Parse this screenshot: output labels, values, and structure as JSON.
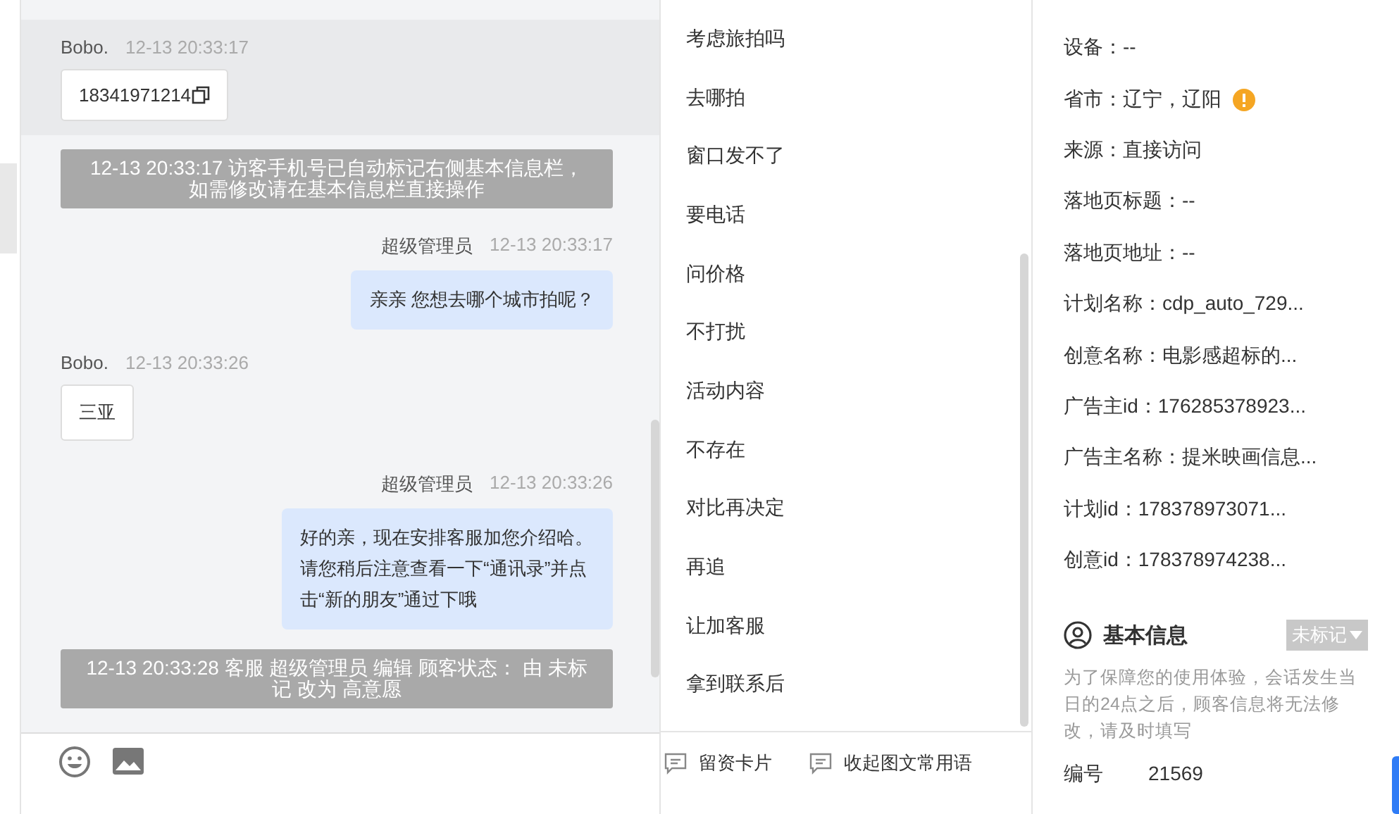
{
  "chat": {
    "messages": [
      {
        "kind": "incoming",
        "sender": "Bobo.",
        "time": "12-13 20:33:17",
        "text": "18341971214",
        "copyable": true,
        "highlighted": true
      },
      {
        "kind": "system",
        "text": "12-13 20:33:17 访客手机号已自动标记右侧基本信息栏，如需修改请在基本信息栏直接操作"
      },
      {
        "kind": "outgoing",
        "sender": "超级管理员",
        "time": "12-13 20:33:17",
        "text": "亲亲 您想去哪个城市拍呢？"
      },
      {
        "kind": "incoming",
        "sender": "Bobo.",
        "time": "12-13 20:33:26",
        "text": "三亚",
        "copyable": false,
        "highlighted": false
      },
      {
        "kind": "outgoing",
        "sender": "超级管理员",
        "time": "12-13 20:33:26",
        "text": "好的亲，现在安排客服加您介绍哈。请您稍后注意查看一下“通讯录”并点击“新的朋友”通过下哦"
      },
      {
        "kind": "system",
        "text": "12-13 20:33:28 客服 超级管理员 编辑 顾客状态： 由 未标记 改为 高意愿"
      }
    ]
  },
  "quick_replies": [
    "考虑旅拍吗",
    "去哪拍",
    "窗口发不了",
    "要电话",
    "问价格",
    "不打扰",
    "活动内容",
    "不存在",
    "对比再决定",
    "再追",
    "让加客服",
    "拿到联系后"
  ],
  "toolbar": {
    "actions": [
      "留资卡片",
      "收起图文常用语"
    ]
  },
  "source_info": {
    "fields": [
      {
        "text": "设备：--",
        "warning": false
      },
      {
        "text": "省市：辽宁，辽阳",
        "warning": true
      },
      {
        "text": "来源：直接访问",
        "warning": false
      },
      {
        "text": "落地页标题：--",
        "warning": false
      },
      {
        "text": "落地页地址：--",
        "warning": false
      },
      {
        "text": "计划名称：cdp_auto_729...",
        "warning": false
      },
      {
        "text": "创意名称：电影感超标的...",
        "warning": false
      },
      {
        "text": "广告主id：176285378923...",
        "warning": false
      },
      {
        "text": "广告主名称：提米映画信息...",
        "warning": false
      },
      {
        "text": "计划id：178378973071...",
        "warning": false
      },
      {
        "text": "创意id：178378974238...",
        "warning": false
      }
    ]
  },
  "basic_info": {
    "title": "基本信息",
    "status": "未标记",
    "notice": "为了保障您的使用体验，会话发生当日的24点之后，顾客信息将无法修改，请及时填写",
    "fields": [
      {
        "label": "编号",
        "value": "21569"
      }
    ]
  }
}
